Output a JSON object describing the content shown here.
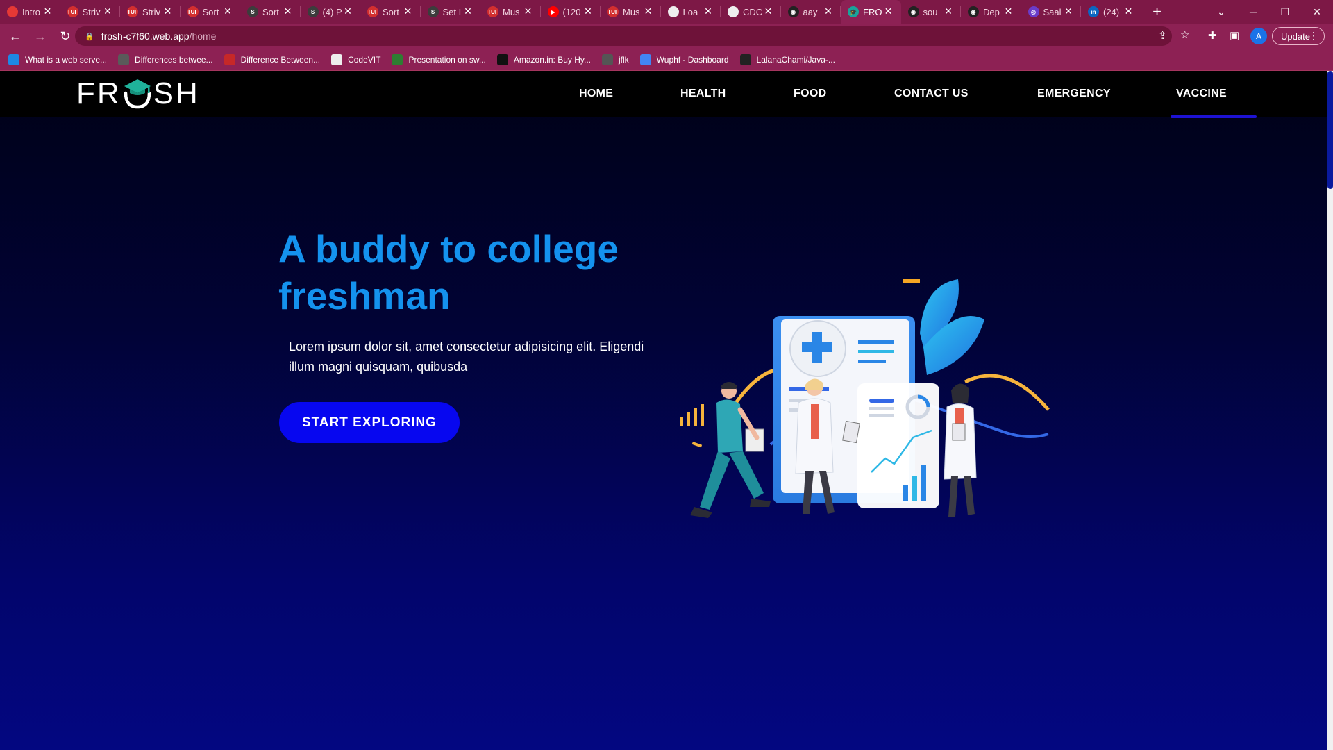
{
  "browser": {
    "tabs": [
      {
        "title": "Intro",
        "color": "#e53935",
        "glyph": ""
      },
      {
        "title": "Striv",
        "color": "#d32f2f",
        "glyph": "TUF"
      },
      {
        "title": "Striv",
        "color": "#d32f2f",
        "glyph": "TUF"
      },
      {
        "title": "Sort",
        "color": "#d32f2f",
        "glyph": "TUF"
      },
      {
        "title": "Sort",
        "color": "#3c3c3c",
        "glyph": "S"
      },
      {
        "title": "(4) P",
        "color": "#3c3c3c",
        "glyph": "S"
      },
      {
        "title": "Sort",
        "color": "#d32f2f",
        "glyph": "TUF"
      },
      {
        "title": "Set I",
        "color": "#3c3c3c",
        "glyph": "S"
      },
      {
        "title": "Mus",
        "color": "#d32f2f",
        "glyph": "TUF"
      },
      {
        "title": "(120",
        "color": "#ff0000",
        "glyph": "▶"
      },
      {
        "title": "Mus",
        "color": "#d32f2f",
        "glyph": "TUF"
      },
      {
        "title": "Loa",
        "color": "#eeeeee",
        "glyph": ""
      },
      {
        "title": "CDC",
        "color": "#eeeeee",
        "glyph": ""
      },
      {
        "title": "aay",
        "color": "#222222",
        "glyph": "◉"
      },
      {
        "title": "FRO",
        "color": "#1aa39a",
        "glyph": "🎓",
        "active": true
      },
      {
        "title": "sou",
        "color": "#222222",
        "glyph": "◉"
      },
      {
        "title": "Dep",
        "color": "#222222",
        "glyph": "◉"
      },
      {
        "title": "Saal",
        "color": "#6a3cc9",
        "glyph": "◎"
      },
      {
        "title": "(24)",
        "color": "#0a66c2",
        "glyph": "in"
      }
    ],
    "url_host": "frosh-c7f60.web.app",
    "url_path": "/home",
    "update_label": "Update",
    "profile_initial": "A",
    "bookmarks": [
      {
        "label": "What is a web serve...",
        "color": "#1e88e5"
      },
      {
        "label": "Differences betwee...",
        "color": "#5a5a5a"
      },
      {
        "label": "Difference Between...",
        "color": "#c62828"
      },
      {
        "label": "CodeVIT",
        "color": "#eeeeee"
      },
      {
        "label": "Presentation on sw...",
        "color": "#2e7d32"
      },
      {
        "label": "Amazon.in: Buy Hy...",
        "color": "#111111"
      },
      {
        "label": "jflk",
        "color": "#555555"
      },
      {
        "label": "Wuphf - Dashboard",
        "color": "#4285f4"
      },
      {
        "label": "LalanaChami/Java-...",
        "color": "#222222"
      }
    ]
  },
  "site": {
    "logo_left": "FR",
    "logo_right": "SH",
    "nav": [
      {
        "label": "HOME",
        "key": "home"
      },
      {
        "label": "HEALTH",
        "key": "health"
      },
      {
        "label": "FOOD",
        "key": "food"
      },
      {
        "label": "CONTACT US",
        "key": "contact"
      },
      {
        "label": "EMERGENCY",
        "key": "emergency"
      },
      {
        "label": "VACCINE",
        "key": "vaccine",
        "active": true
      }
    ],
    "hero": {
      "title": "A buddy to college freshman",
      "text": "Lorem ipsum dolor sit, amet consectetur adipisicing elit. Eligendi illum magni quisquam, quibusda",
      "cta": "START EXPLORING"
    }
  }
}
